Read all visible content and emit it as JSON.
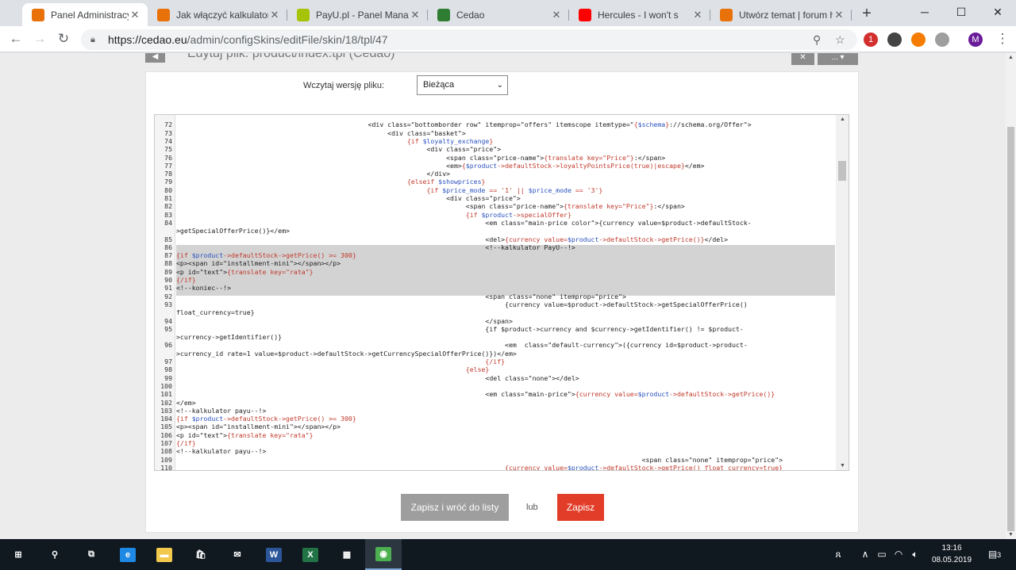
{
  "tabs": [
    {
      "title": "Panel Administracyjny - ",
      "favicon": "panel-favicon",
      "color": "#e8710a",
      "active": true
    },
    {
      "title": "Jak włączyć kalkulator r",
      "favicon": "forum-favicon",
      "color": "#e8710a",
      "active": false
    },
    {
      "title": "PayU.pl - Panel Manage",
      "favicon": "payu-favicon",
      "color": "#a6c307",
      "active": false
    },
    {
      "title": "Cedao",
      "favicon": "cedao-favicon",
      "color": "#2e7d32",
      "active": false
    },
    {
      "title": "Hercules - I won't s",
      "favicon": "youtube-favicon",
      "color": "#ff0000",
      "active": false
    },
    {
      "title": "Utwórz temat | forum h",
      "favicon": "forum-favicon",
      "color": "#e8710a",
      "active": false
    }
  ],
  "window_controls": {
    "minimize": "─",
    "maximize": "☐",
    "close": "✕",
    "new_tab": "+"
  },
  "toolbar": {
    "url_host": "https://cedao.eu",
    "url_path": "/admin/configSkins/editFile/skin/18/tpl/47",
    "profile_initial": "M",
    "ext_badge": "1"
  },
  "page": {
    "title": "Edytuj plik: product/index.tpl (Cedao)",
    "more_button": "...",
    "version_label": "Wczytaj wersję pliku:",
    "version_value": "Bieżąca",
    "save_back_label": "Zapisz i wróć do listy",
    "or_label": "lub",
    "save_label": "Zapisz"
  },
  "code_lines": [
    {
      "n": "",
      "t": ""
    },
    {
      "n": "72",
      "t": "                                                 <div class=\"bottomborder row\" itemprop=\"offers\" itemscope itemtype=\"{$schema}://schema.org/Offer\">"
    },
    {
      "n": "73",
      "t": "                                                      <div class=\"basket\">"
    },
    {
      "n": "74",
      "t": "                                                           {if $loyalty_exchange}"
    },
    {
      "n": "75",
      "t": "                                                                <div class=\"price\">"
    },
    {
      "n": "76",
      "t": "                                                                     <span class=\"price-name\">{translate key=\"Price\"}:</span>"
    },
    {
      "n": "77",
      "t": "                                                                     <em>{$product->defaultStock->loyaltyPointsPrice(true)|escape}</em>"
    },
    {
      "n": "78",
      "t": "                                                                </div>"
    },
    {
      "n": "79",
      "t": "                                                           {elseif $showprices}"
    },
    {
      "n": "80",
      "t": "                                                                {if $price_mode == '1' || $price_mode == '3'}"
    },
    {
      "n": "81",
      "t": "                                                                     <div class=\"price\">"
    },
    {
      "n": "82",
      "t": "                                                                          <span class=\"price-name\">{translate key=\"Price\"}:</span>"
    },
    {
      "n": "83",
      "t": "                                                                          {if $product->specialOffer}"
    },
    {
      "n": "84",
      "t": "                                                                               <em class=\"main-price color\">{currency value=$product->defaultStock-"
    },
    {
      "n": "",
      "t": ">getSpecialOfferPrice()}</em>"
    },
    {
      "n": "85",
      "t": "                                                                               <del>{currency value=$product->defaultStock->getPrice()}</del>"
    },
    {
      "n": "86",
      "t": "                                                                               <!--kalkulator PayU--!>"
    },
    {
      "n": "87",
      "t": "{if $product->defaultStock->getPrice() >= 300}"
    },
    {
      "n": "88",
      "t": "<p><span id=\"installment-mini\"></span></p>"
    },
    {
      "n": "89",
      "t": "<p id=\"text\">{translate key=\"rata\"}"
    },
    {
      "n": "90",
      "t": "{/if}"
    },
    {
      "n": "91",
      "t": "<!--koniec--!>"
    },
    {
      "n": "92",
      "t": "                                                                               <span class=\"none\" itemprop=\"price\">"
    },
    {
      "n": "93",
      "t": "                                                                                    {currency value=$product->defaultStock->getSpecialOfferPrice()"
    },
    {
      "n": "",
      "t": "float_currency=true}"
    },
    {
      "n": "94",
      "t": "                                                                               </span>"
    },
    {
      "n": "95",
      "t": "                                                                               {if $product->currency and $currency->getIdentifier() != $product-"
    },
    {
      "n": "",
      "t": ">currency->getIdentifier()}"
    },
    {
      "n": "96",
      "t": "                                                                                    <em  class=\"default-currency\">({currency id=$product->product-"
    },
    {
      "n": "",
      "t": ">currency_id rate=1 value=$product->defaultStock->getCurrencySpecialOfferPrice()})</em>"
    },
    {
      "n": "97",
      "t": "                                                                               {/if}"
    },
    {
      "n": "98",
      "t": "                                                                          {else}"
    },
    {
      "n": "99",
      "t": "                                                                               <del class=\"none\"></del>"
    },
    {
      "n": "100",
      "t": ""
    },
    {
      "n": "101",
      "t": "                                                                               <em class=\"main-price\">{currency value=$product->defaultStock->getPrice()}"
    },
    {
      "n": "102",
      "t": "</em>"
    },
    {
      "n": "103",
      "t": "<!--kalkulator payu--!>"
    },
    {
      "n": "104",
      "t": "{if $product->defaultStock->getPrice() >= 300}"
    },
    {
      "n": "105",
      "t": "<p><span id=\"installment-mini\"></span></p>"
    },
    {
      "n": "106",
      "t": "<p id=\"text\">{translate key=\"rata\"}"
    },
    {
      "n": "107",
      "t": "{/if}"
    },
    {
      "n": "108",
      "t": "<!--kalkulator payu--!>"
    },
    {
      "n": "109",
      "t": "                                                                                                                       <span class=\"none\" itemprop=\"price\">"
    },
    {
      "n": "110",
      "t": "                                                                                    {currency value=$product->defaultStock->getPrice() float_currency=true}"
    }
  ],
  "highlighted_lines": [
    16,
    17,
    18,
    19,
    20,
    21
  ],
  "taskbar": {
    "items": [
      {
        "name": "start-icon",
        "glyph": "⊞",
        "color": "transparent"
      },
      {
        "name": "search-icon",
        "glyph": "⚲",
        "color": "transparent"
      },
      {
        "name": "task-view-icon",
        "glyph": "⧉",
        "color": "transparent"
      },
      {
        "name": "edge-icon",
        "glyph": "e",
        "color": "#1e88e5"
      },
      {
        "name": "file-explorer-icon",
        "glyph": "▬",
        "color": "#f2c94c"
      },
      {
        "name": "store-icon",
        "glyph": "🛍",
        "color": "transparent"
      },
      {
        "name": "mail-icon",
        "glyph": "✉",
        "color": "transparent"
      },
      {
        "name": "word-icon",
        "glyph": "W",
        "color": "#2b579a"
      },
      {
        "name": "excel-icon",
        "glyph": "X",
        "color": "#217346"
      },
      {
        "name": "app-icon",
        "glyph": "▦",
        "color": "transparent"
      },
      {
        "name": "chrome-icon",
        "glyph": "◉",
        "color": "#4caf50"
      }
    ],
    "time": "13:16",
    "date": "08.05.2019",
    "notifications": "3"
  }
}
